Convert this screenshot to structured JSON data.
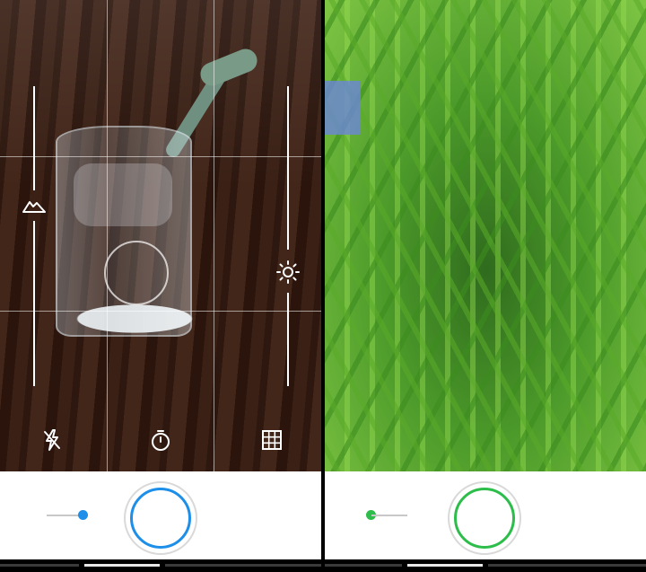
{
  "screens": [
    {
      "id": "left",
      "scene": "glass-of-water",
      "accent_color": "#1e8fe8",
      "overlay": {
        "grid_visible": true,
        "left_slider_icon": "mountain-icon",
        "right_slider_icon": "brightness-icon",
        "toolbar_icons": [
          "flash-off-icon",
          "timer-icon",
          "grid-icon"
        ]
      },
      "mode_selector": {
        "dot_color": "#1e8fe8",
        "dot_side": "right"
      }
    },
    {
      "id": "right",
      "scene": "green-plant",
      "accent_color": "#2dbd4a",
      "overlay": {
        "grid_visible": false
      },
      "mode_selector": {
        "dot_color": "#2dbd4a",
        "dot_side": "left"
      }
    }
  ]
}
